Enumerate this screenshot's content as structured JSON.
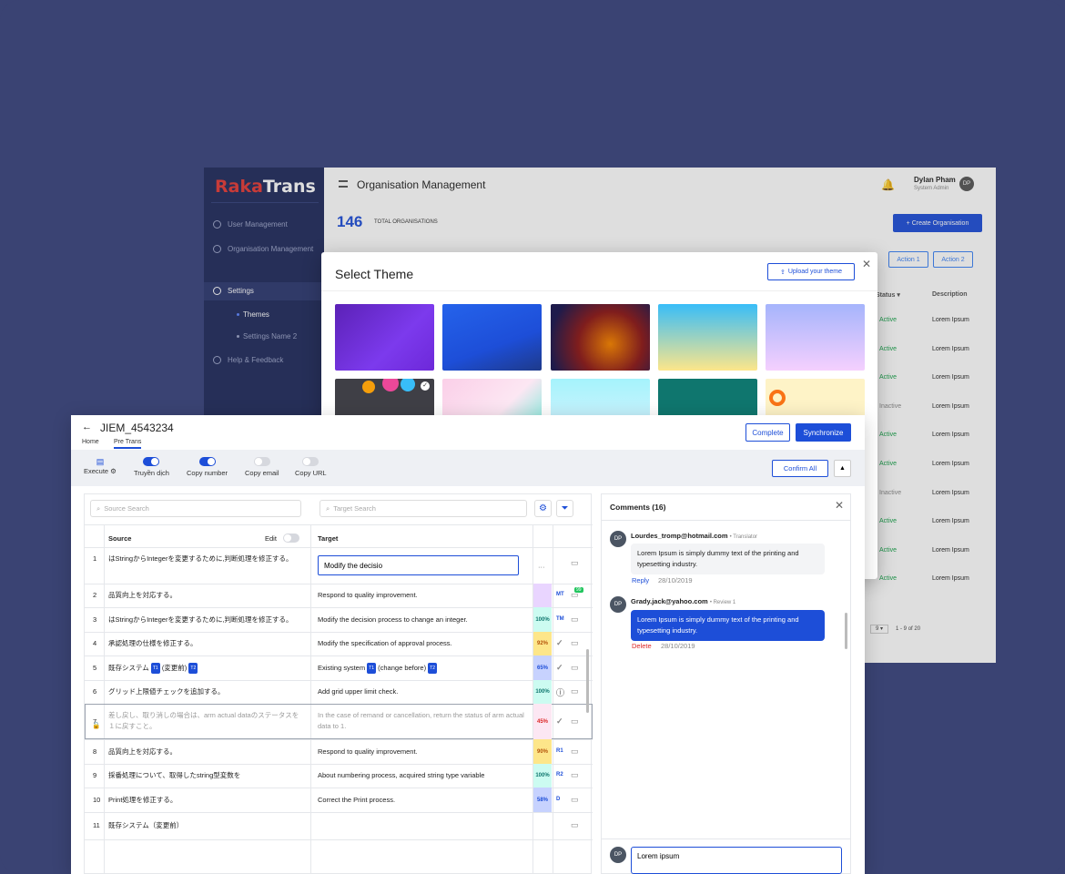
{
  "back": {
    "logo_a": "Raka",
    "logo_b": "Trans",
    "nav": [
      "User Management",
      "Organisation Management",
      "Settings",
      "Help & Feedback"
    ],
    "sub": [
      "Themes",
      "Settings Name 2"
    ],
    "title": "Organisation Management",
    "user_name": "Dylan Pham",
    "user_role": "System Admin",
    "avatar": "DP",
    "total_count": "146",
    "total_label": "TOTAL ORGANISATIONS",
    "create_label": "+ Create Organisation",
    "action1": "Action 1",
    "action2": "Action 2",
    "col_status": "Status ▾",
    "col_desc": "Description",
    "rows": [
      {
        "status": "Active",
        "desc": "Lorem Ipsum"
      },
      {
        "status": "Active",
        "desc": "Lorem Ipsum"
      },
      {
        "status": "Active",
        "desc": "Lorem Ipsum"
      },
      {
        "status": "Inactive",
        "desc": "Lorem Ipsum"
      },
      {
        "status": "Active",
        "desc": "Lorem Ipsum"
      },
      {
        "status": "Active",
        "desc": "Lorem Ipsum"
      },
      {
        "status": "Inactive",
        "desc": "Lorem Ipsum"
      },
      {
        "status": "Active",
        "desc": "Lorem Ipsum"
      },
      {
        "status": "Active",
        "desc": "Lorem Ipsum"
      },
      {
        "status": "Active",
        "desc": "Lorem Ipsum"
      }
    ],
    "page_size": "9 ▾",
    "page_range": "1 - 9 of 20"
  },
  "modal": {
    "title": "Select Theme",
    "upload_label": "Upload your theme"
  },
  "editor": {
    "title": "JIEM_4543234",
    "tabs": [
      "Home",
      "Pre Trans"
    ],
    "complete_label": "Complete",
    "sync_label": "Synchronize",
    "tools": [
      "Execute ⚙",
      "Truyền dịch",
      "Copy number",
      "Copy email",
      "Copy URL"
    ],
    "confirm_label": "Confirm All",
    "source_search": "Source Search",
    "target_search": "Target Search",
    "col_source": "Source",
    "col_edit": "Edit",
    "col_target": "Target",
    "edit_value": "Modify the decisio",
    "rows": [
      {
        "n": "1",
        "src": "はStringからIntegerを変更するために,判断処理を修正する。",
        "tgt": "",
        "pct": "",
        "pct_color": "",
        "tag": ""
      },
      {
        "n": "2",
        "src": "品質向上を対応する。",
        "tgt": "Respond to quality improvement.",
        "pct": "",
        "pct_color": "#e9d5ff",
        "tag": "MT"
      },
      {
        "n": "3",
        "src": "はStringからIntegerを変更するために,判断処理を修正する。",
        "tgt": "Modify the decision process to change an integer.",
        "pct": "100%",
        "pct_color": "#ccfbf1",
        "tag": "TM"
      },
      {
        "n": "4",
        "src": "承認処理の仕様を修正する。",
        "tgt": "Modify the specification of approval process.",
        "pct": "92%",
        "pct_color": "#fde68a",
        "tag": ""
      },
      {
        "n": "5",
        "src": "既存システム",
        "tgt": "Existing system",
        "pct": "65%",
        "pct_color": "#c7d2fe",
        "tag": ""
      },
      {
        "n": "6",
        "src": "グリッド上限値チェックを追加する。",
        "tgt": "Add grid upper limit check.",
        "pct": "100%",
        "pct_color": "#ccfbf1",
        "tag": ""
      },
      {
        "n": "7",
        "src": "差し戻し、取り消しの場合は、arm actual dataのステータスを１に戻すこと。",
        "tgt": "In the case of remand or cancellation, return the status of arm actual data to 1.",
        "pct": "45%",
        "pct_color": "#fce7f3",
        "tag": ""
      },
      {
        "n": "8",
        "src": "品質向上を対応する。",
        "tgt": "Respond to quality improvement.",
        "pct": "90%",
        "pct_color": "#fde68a",
        "tag": "R1"
      },
      {
        "n": "9",
        "src": "採番処理について、取得したstring型変数を",
        "tgt": "About numbering process, acquired string type variable",
        "pct": "100%",
        "pct_color": "#ccfbf1",
        "tag": "R2"
      },
      {
        "n": "10",
        "src": "Print処理を修正する。",
        "tgt": "Correct the Print process.",
        "pct": "58%",
        "pct_color": "#c7d2fe",
        "tag": "D"
      },
      {
        "n": "11",
        "src": "既存システム（変更前）",
        "tgt": "",
        "pct": "",
        "pct_color": "",
        "tag": ""
      }
    ],
    "row5_src_extra": "(変更前)",
    "row5_tgt_extra": "(change before)",
    "badge_t1": "T1",
    "badge_t2": "T2",
    "comment_badge": "99",
    "ellipsis": "···"
  },
  "comments": {
    "title": "Comments (16)",
    "items": [
      {
        "av": "DP",
        "email": "Lourdes_tromp@hotmail.com",
        "role": "• Translator",
        "text": "Lorem Ipsum is simply dummy text of the printing and typesetting industry.",
        "link": "Reply",
        "date": "28/10/2019"
      },
      {
        "av": "DP",
        "email": "Grady.jack@yahoo.com",
        "role": "• Review 1",
        "text": "Lorem Ipsum is simply dummy text of the printing and typesetting industry.",
        "link": "Delete",
        "date": "28/10/2019"
      }
    ],
    "input_avatar": "DP",
    "input_value": "Lorem ipsum"
  }
}
